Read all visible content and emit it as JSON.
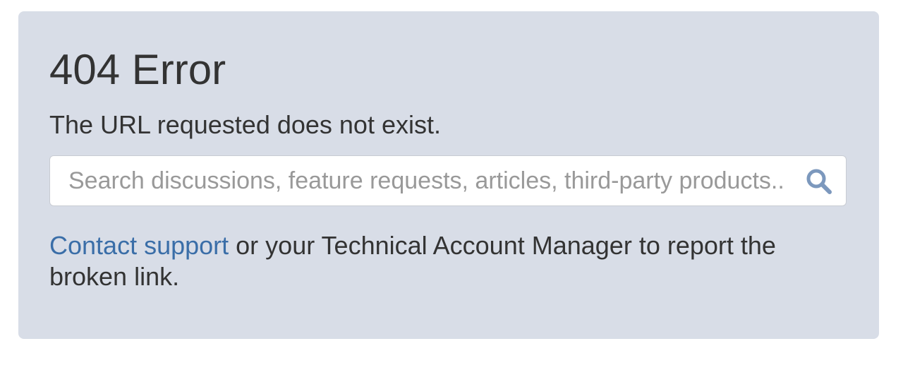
{
  "error": {
    "title": "404 Error",
    "message": "The URL requested does not exist."
  },
  "search": {
    "placeholder": "Search discussions, feature requests, articles, third-party products..",
    "value": "",
    "icon": "search-icon"
  },
  "footer": {
    "link_label": "Contact support",
    "rest_text": " or your Technical Account Manager to report the broken link."
  },
  "colors": {
    "panel_background": "#d8dde7",
    "link": "#3a6ea8",
    "search_icon": "#7c98bd"
  }
}
